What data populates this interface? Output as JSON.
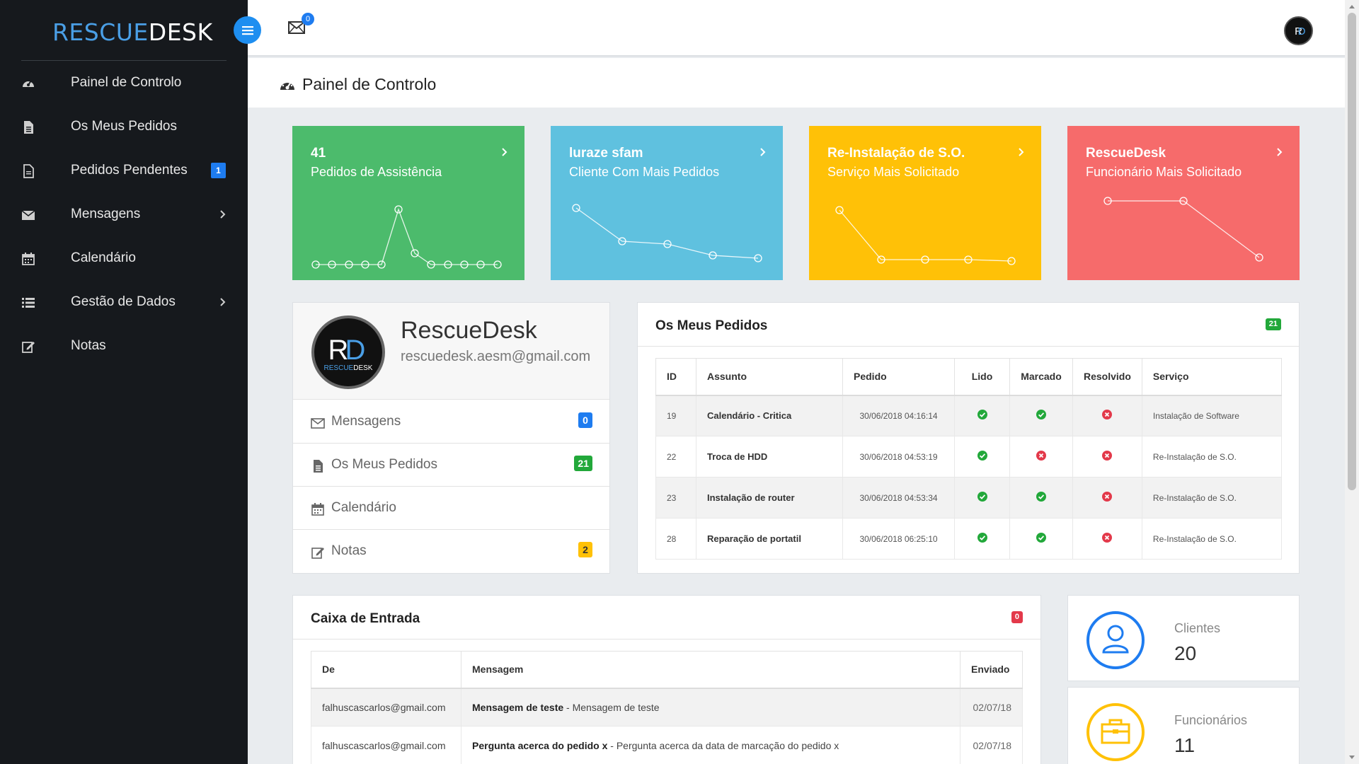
{
  "brand": {
    "part1": "RESCUE",
    "part2": "DESK"
  },
  "sidebar": {
    "items": [
      {
        "label": "Painel de Controlo",
        "icon": "dashboard-icon"
      },
      {
        "label": "Os Meus Pedidos",
        "icon": "file-icon"
      },
      {
        "label": "Pedidos Pendentes",
        "icon": "file-outline-icon",
        "badge": "1"
      },
      {
        "label": "Mensagens",
        "icon": "envelope-icon",
        "chevron": true
      },
      {
        "label": "Calendário",
        "icon": "calendar-icon"
      },
      {
        "label": "Gestão de Dados",
        "icon": "list-icon",
        "chevron": true
      },
      {
        "label": "Notas",
        "icon": "edit-icon"
      }
    ]
  },
  "topbar": {
    "mail_count": "0"
  },
  "page": {
    "title": "Painel de Controlo"
  },
  "cards": [
    {
      "line1": "41",
      "line2": "Pedidos de Assistência",
      "color": "#4cbb6c"
    },
    {
      "line1": "luraze sfam",
      "line2": "Cliente Com Mais Pedidos",
      "color": "#5fc1df"
    },
    {
      "line1": "Re-Instalação de S.O.",
      "line2": "Serviço Mais Solicitado",
      "color": "#ffc107"
    },
    {
      "line1": "RescueDesk",
      "line2": "Funcionário Mais Solicitado",
      "color": "#f66b6b"
    }
  ],
  "profile": {
    "name": "RescueDesk",
    "email": "rescuedesk.aesm@gmail.com",
    "links": [
      {
        "label": "Mensagens",
        "badge": "0",
        "badge_color": "#1e7cf0"
      },
      {
        "label": "Os Meus Pedidos",
        "badge": "21",
        "badge_color": "#22a83a"
      },
      {
        "label": "Calendário",
        "badge": "",
        "badge_color": ""
      },
      {
        "label": "Notas",
        "badge": "2",
        "badge_color": "#ffc107"
      }
    ]
  },
  "orders": {
    "title": "Os Meus Pedidos",
    "badge": "21",
    "columns": [
      "ID",
      "Assunto",
      "Pedido",
      "Lido",
      "Marcado",
      "Resolvido",
      "Serviço"
    ],
    "rows": [
      {
        "id": "19",
        "subject": "Calendário - Critica",
        "date": "30/06/2018 04:16:14",
        "lido": true,
        "marcado": true,
        "resolvido": false,
        "service": "Instalação de Software"
      },
      {
        "id": "22",
        "subject": "Troca de HDD",
        "date": "30/06/2018 04:53:19",
        "lido": true,
        "marcado": false,
        "resolvido": false,
        "service": "Re-Instalação de S.O."
      },
      {
        "id": "23",
        "subject": "Instalação de router",
        "date": "30/06/2018 04:53:34",
        "lido": true,
        "marcado": true,
        "resolvido": false,
        "service": "Re-Instalação de S.O."
      },
      {
        "id": "28",
        "subject": "Reparação de portatil",
        "date": "30/06/2018 06:25:10",
        "lido": true,
        "marcado": true,
        "resolvido": false,
        "service": "Re-Instalação de S.O."
      }
    ]
  },
  "inbox": {
    "title": "Caixa de Entrada",
    "badge": "0",
    "columns": [
      "De",
      "Mensagem",
      "Enviado"
    ],
    "rows": [
      {
        "from": "falhuscascarlos@gmail.com",
        "subject": "Mensagem de teste",
        "body": " - Mensagem de teste",
        "sent": "02/07/18"
      },
      {
        "from": "falhuscascarlos@gmail.com",
        "subject": "Pergunta acerca do pedido x",
        "body": " - Pergunta acerca da data de marcação do pedido x",
        "sent": "02/07/18"
      }
    ]
  },
  "stats": [
    {
      "label": "Clientes",
      "value": "20",
      "color": "#1e7cf0",
      "icon": "user-icon"
    },
    {
      "label": "Funcionários",
      "value": "11",
      "color": "#ffc107",
      "icon": "briefcase-icon"
    }
  ]
}
